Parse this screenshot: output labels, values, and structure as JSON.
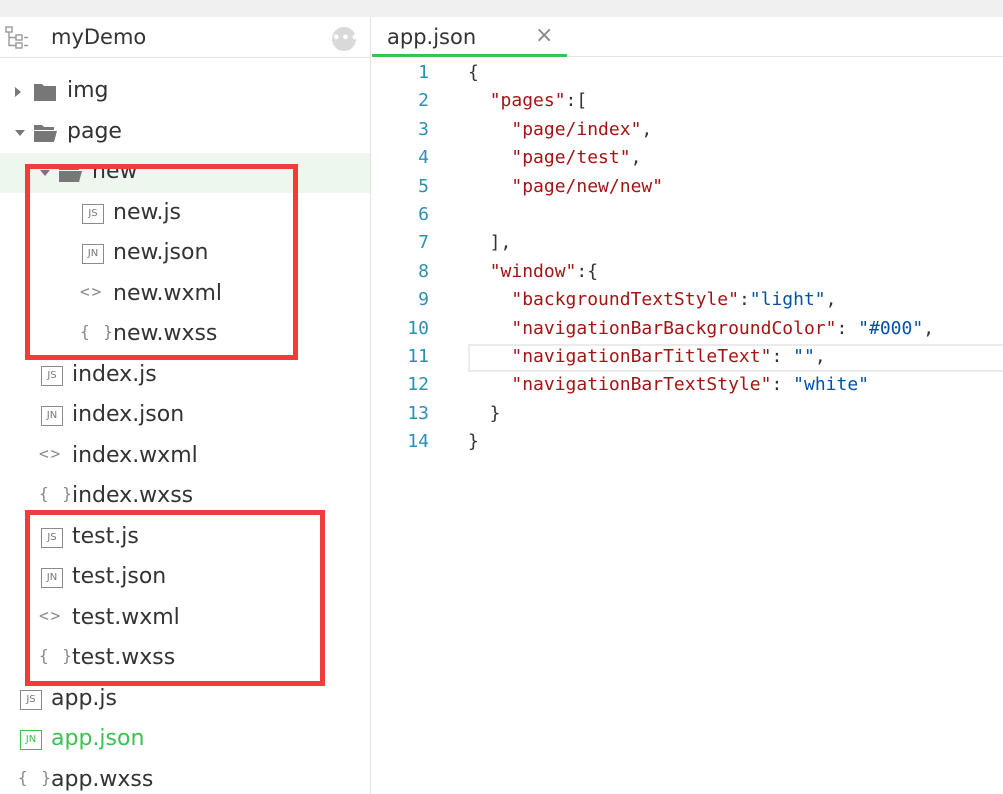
{
  "sidebar": {
    "project_name": "myDemo",
    "more_label": "•••",
    "items": [
      {
        "label": "img",
        "type": "folder",
        "expanded": false
      },
      {
        "label": "page",
        "type": "folder",
        "expanded": true
      },
      {
        "label": "new",
        "type": "folder",
        "expanded": true,
        "selected": true
      },
      {
        "label": "new.js",
        "type": "js",
        "badge": "JS"
      },
      {
        "label": "new.json",
        "type": "json",
        "badge": "JN"
      },
      {
        "label": "new.wxml",
        "type": "wxml",
        "glyph": "<>"
      },
      {
        "label": "new.wxss",
        "type": "wxss",
        "glyph": "{ }"
      },
      {
        "label": "index.js",
        "type": "js",
        "badge": "JS"
      },
      {
        "label": "index.json",
        "type": "json",
        "badge": "JN"
      },
      {
        "label": "index.wxml",
        "type": "wxml",
        "glyph": "<>"
      },
      {
        "label": "index.wxss",
        "type": "wxss",
        "glyph": "{ }"
      },
      {
        "label": "test.js",
        "type": "js",
        "badge": "JS"
      },
      {
        "label": "test.json",
        "type": "json",
        "badge": "JN"
      },
      {
        "label": "test.wxml",
        "type": "wxml",
        "glyph": "<>"
      },
      {
        "label": "test.wxss",
        "type": "wxss",
        "glyph": "{ }"
      },
      {
        "label": "app.js",
        "type": "js",
        "badge": "JS"
      },
      {
        "label": "app.json",
        "type": "json",
        "badge": "JN",
        "active": true
      },
      {
        "label": "app.wxss",
        "type": "wxss",
        "glyph": "{ }"
      }
    ]
  },
  "editor": {
    "tab_title": "app.json",
    "tab_close": "×",
    "current_line": 11,
    "lines": [
      {
        "n": "1",
        "tokens": [
          [
            "p",
            "{"
          ]
        ]
      },
      {
        "n": "2",
        "tokens": [
          [
            "p",
            "  "
          ],
          [
            "k",
            "\"pages\""
          ],
          [
            "p",
            ":["
          ]
        ]
      },
      {
        "n": "3",
        "tokens": [
          [
            "p",
            "    "
          ],
          [
            "k",
            "\"page/index\""
          ],
          [
            "p",
            ","
          ]
        ]
      },
      {
        "n": "4",
        "tokens": [
          [
            "p",
            "    "
          ],
          [
            "k",
            "\"page/test\""
          ],
          [
            "p",
            ","
          ]
        ]
      },
      {
        "n": "5",
        "tokens": [
          [
            "p",
            "    "
          ],
          [
            "k",
            "\"page/new/new\""
          ]
        ]
      },
      {
        "n": "6",
        "tokens": []
      },
      {
        "n": "7",
        "tokens": [
          [
            "p",
            "  ],"
          ]
        ]
      },
      {
        "n": "8",
        "tokens": [
          [
            "p",
            "  "
          ],
          [
            "k",
            "\"window\""
          ],
          [
            "p",
            ":{"
          ]
        ]
      },
      {
        "n": "9",
        "tokens": [
          [
            "p",
            "    "
          ],
          [
            "k",
            "\"backgroundTextStyle\""
          ],
          [
            "p",
            ":"
          ],
          [
            "v",
            "\"light\""
          ],
          [
            "p",
            ","
          ]
        ]
      },
      {
        "n": "10",
        "tokens": [
          [
            "p",
            "    "
          ],
          [
            "k",
            "\"navigationBarBackgroundColor\""
          ],
          [
            "p",
            ": "
          ],
          [
            "v",
            "\"#000\""
          ],
          [
            "p",
            ","
          ]
        ]
      },
      {
        "n": "11",
        "tokens": [
          [
            "p",
            "    "
          ],
          [
            "k",
            "\"navigationBarTitleText\""
          ],
          [
            "p",
            ": "
          ],
          [
            "v",
            "\"\""
          ],
          [
            "p",
            ","
          ]
        ]
      },
      {
        "n": "12",
        "tokens": [
          [
            "p",
            "    "
          ],
          [
            "k",
            "\"navigationBarTextStyle\""
          ],
          [
            "p",
            ": "
          ],
          [
            "v",
            "\"white\""
          ]
        ]
      },
      {
        "n": "13",
        "tokens": [
          [
            "p",
            "  }"
          ]
        ]
      },
      {
        "n": "14",
        "tokens": [
          [
            "p",
            "}"
          ]
        ]
      }
    ]
  },
  "colors": {
    "accent_green": "#3cc051",
    "highlight_red": "#f03c3c",
    "line_number": "#2b91af",
    "json_key": "#a31515",
    "json_value": "#0451a5"
  }
}
